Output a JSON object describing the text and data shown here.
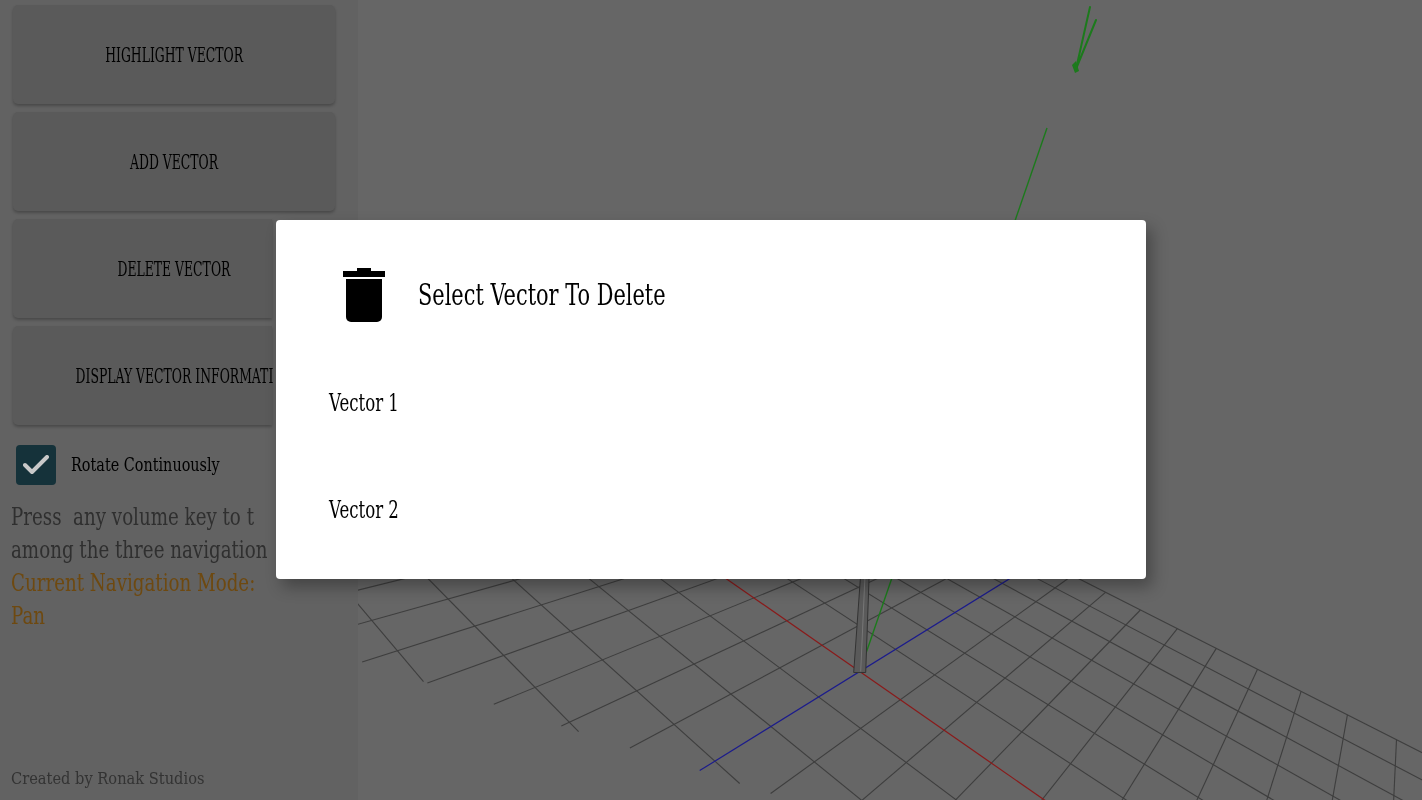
{
  "sidebar": {
    "buttons": [
      "HIGHLIGHT VECTOR",
      "ADD VECTOR",
      "DELETE VECTOR",
      "DISPLAY VECTOR INFORMATI"
    ],
    "rotate_checkbox": {
      "label": "Rotate Continuously",
      "checked": true
    },
    "hint_lines": [
      "Press  any volume key to t",
      "among the three navigation"
    ],
    "navigation_mode": {
      "label": "Current Navigation Mode:",
      "value": "Pan"
    },
    "credit": "Created by Ronak Studios"
  },
  "dialog": {
    "title": "Select Vector To Delete",
    "items": [
      {
        "label": "Vector 1"
      },
      {
        "label": "Vector 2"
      }
    ]
  }
}
